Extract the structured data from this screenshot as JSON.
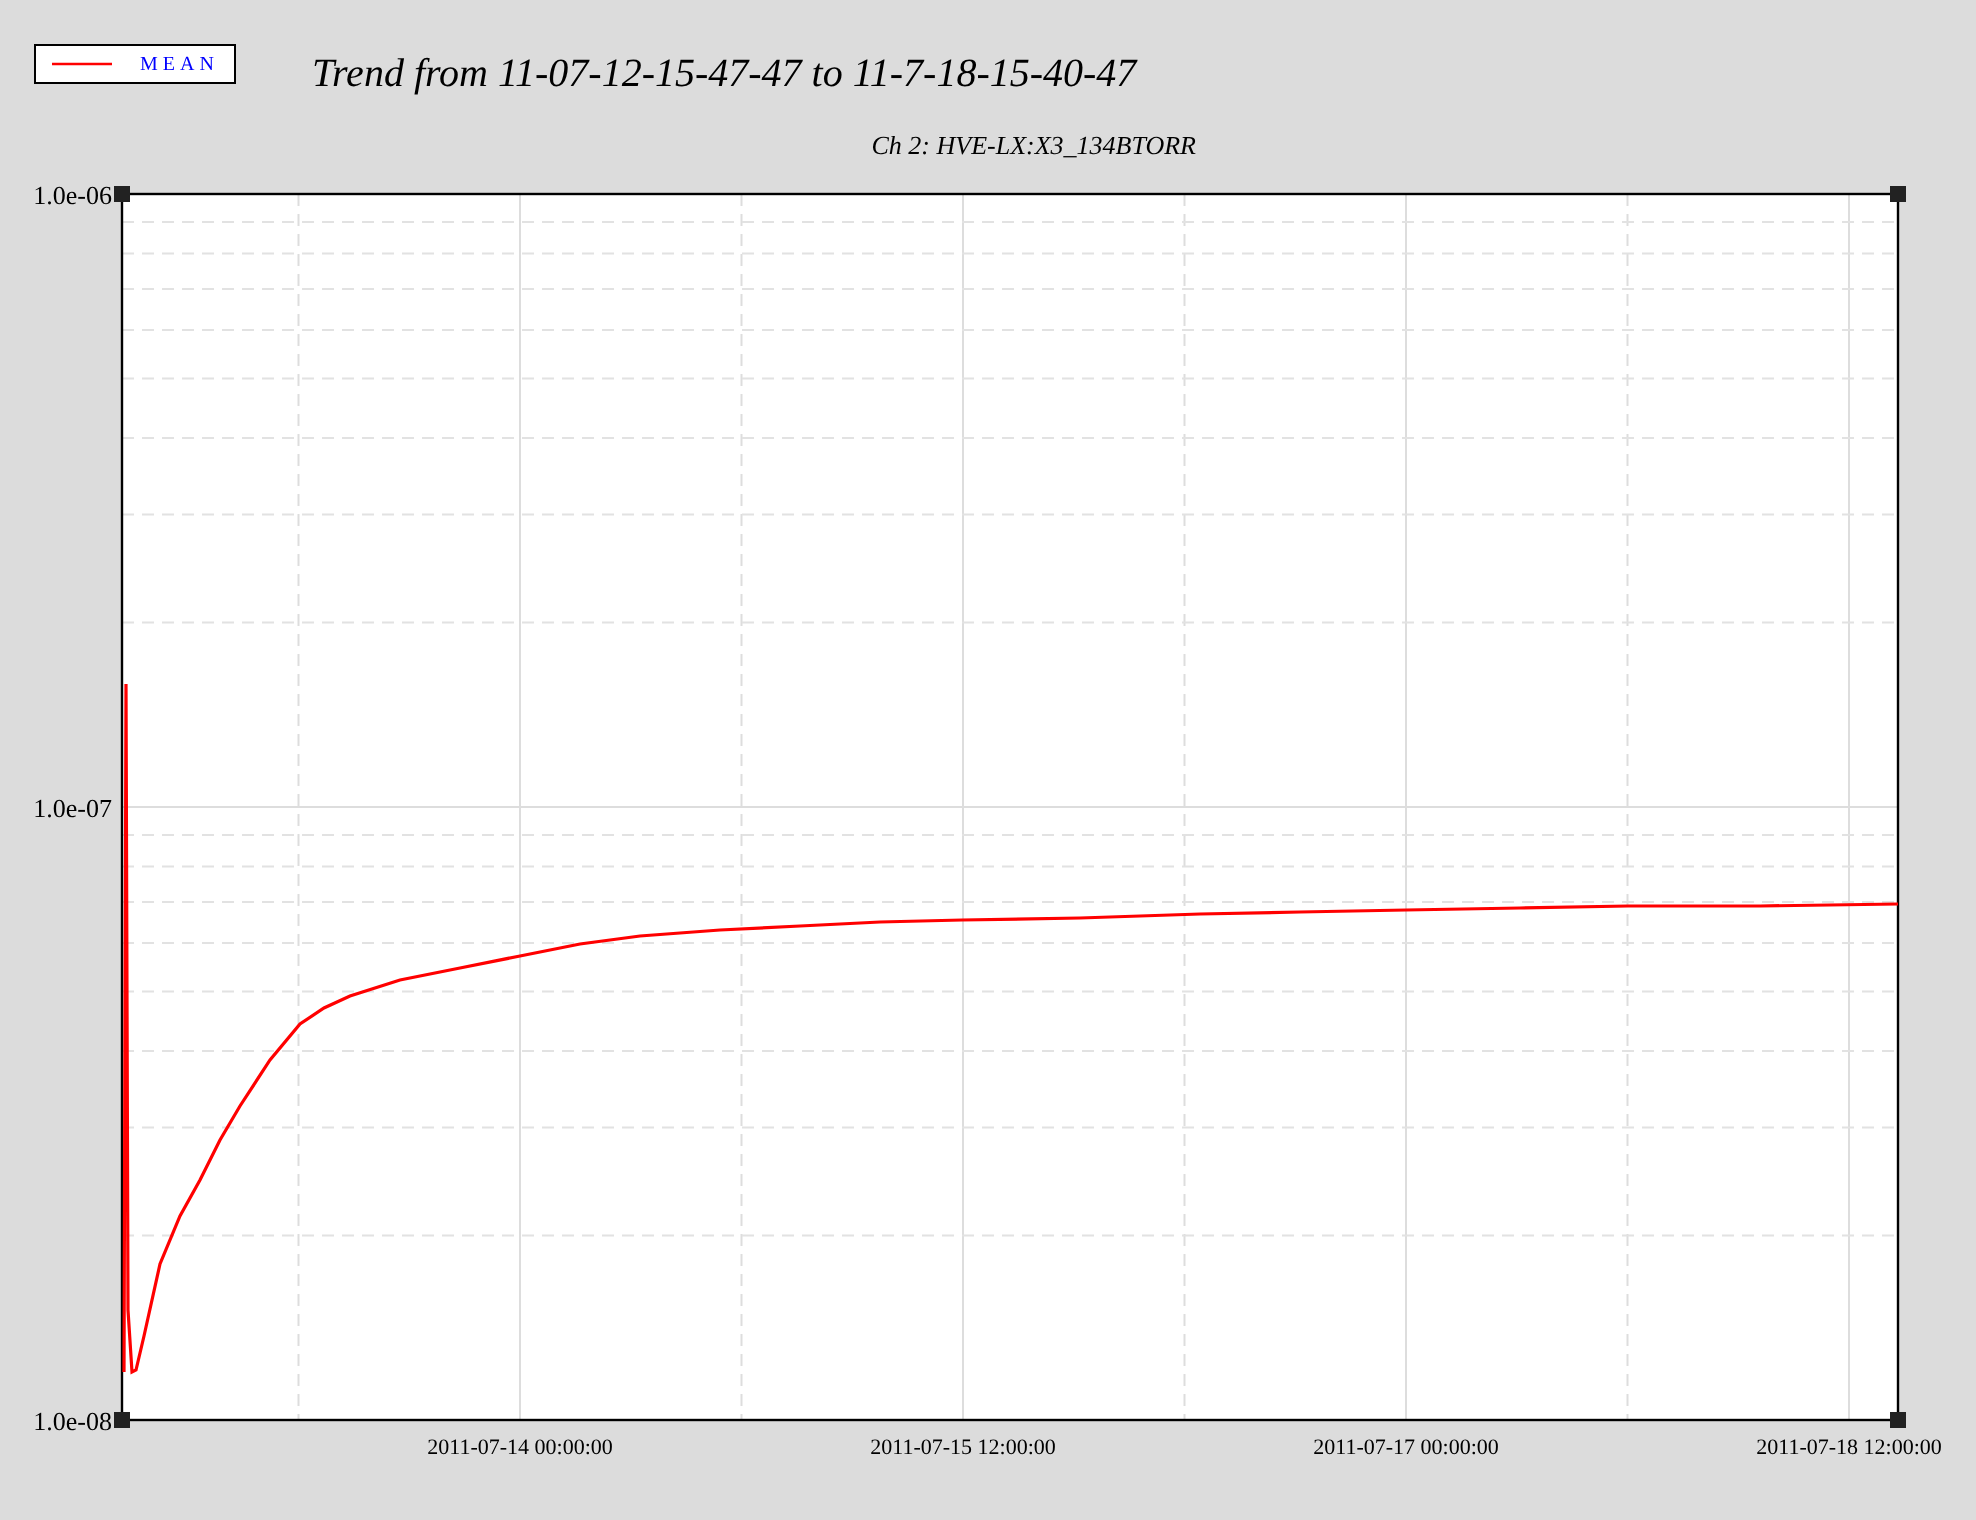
{
  "legend": {
    "label": "MEAN"
  },
  "title": "Trend from 11-07-12-15-47-47 to 11-7-18-15-40-47",
  "chart": {
    "title": "Ch 2: HVE-LX:X3_134BTORR",
    "y_axis_labels": [
      "1.0e-06",
      "1.0e-07",
      "1.0e-08"
    ],
    "x_axis_labels": [
      "2011-07-14 00:00:00",
      "2011-07-15 12:00:00",
      "2011-07-17 00:00:00",
      "2011-07-18 12:00:00"
    ]
  }
}
